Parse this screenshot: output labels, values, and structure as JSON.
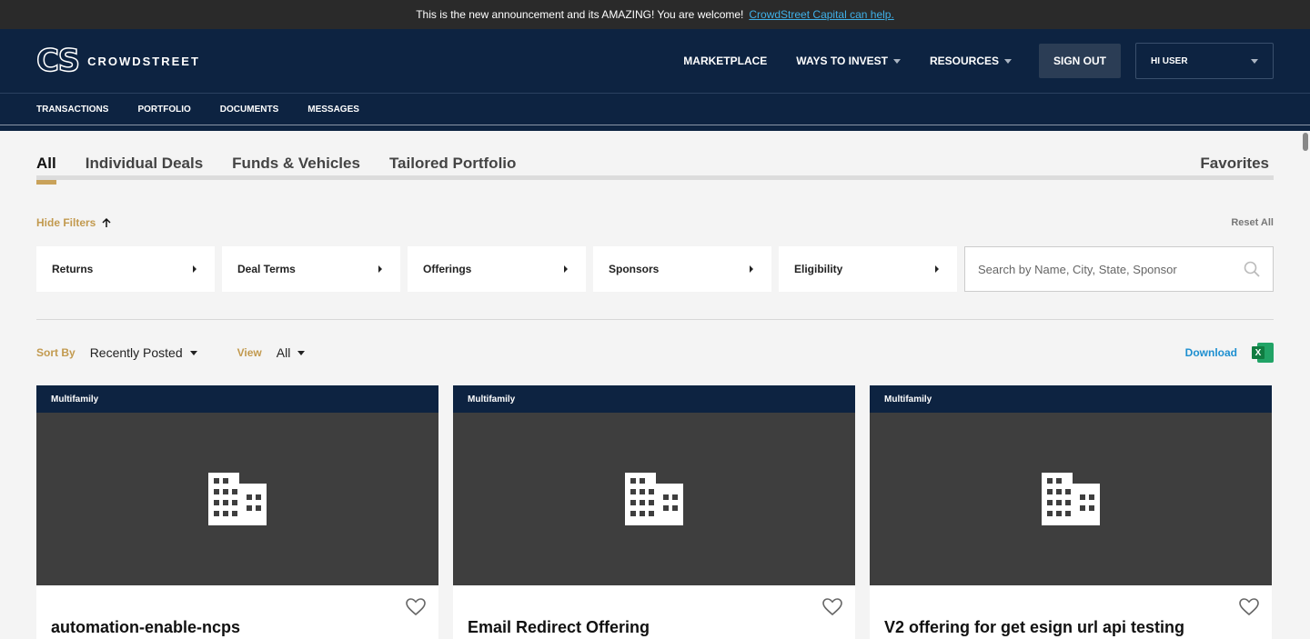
{
  "announcement": {
    "text": "This is the new announcement and its AMAZING! You are welcome!",
    "link": "CrowdStreet Capital can help."
  },
  "header": {
    "logo_mark": "CS",
    "logo_text": "CROWDSTREET",
    "nav": {
      "marketplace": "MARKETPLACE",
      "ways_to_invest": "WAYS TO INVEST",
      "resources": "RESOURCES"
    },
    "sign_out": "SIGN OUT",
    "user": "HI USER"
  },
  "subnav": {
    "transactions": "TRANSACTIONS",
    "portfolio": "PORTFOLIO",
    "documents": "DOCUMENTS",
    "messages": "MESSAGES"
  },
  "tabs": {
    "all": "All",
    "individual": "Individual Deals",
    "funds": "Funds & Vehicles",
    "tailored": "Tailored Portfolio",
    "favorites": "Favorites"
  },
  "filters": {
    "hide": "Hide Filters",
    "reset": "Reset All",
    "returns": "Returns",
    "deal_terms": "Deal Terms",
    "offerings": "Offerings",
    "sponsors": "Sponsors",
    "eligibility": "Eligibility",
    "search_placeholder": "Search by Name, City, State, Sponsor"
  },
  "sort": {
    "sort_label": "Sort By",
    "sort_value": "Recently Posted",
    "view_label": "View",
    "view_value": "All",
    "download": "Download",
    "excel_letter": "X"
  },
  "cards": [
    {
      "category": "Multifamily",
      "title": "automation-enable-ncps"
    },
    {
      "category": "Multifamily",
      "title": "Email Redirect Offering"
    },
    {
      "category": "Multifamily",
      "title": "V2 offering for get esign url api testing"
    }
  ],
  "colors": {
    "navy": "#0d2341",
    "gold": "#c9a25a",
    "link_blue": "#1d8fd0"
  }
}
